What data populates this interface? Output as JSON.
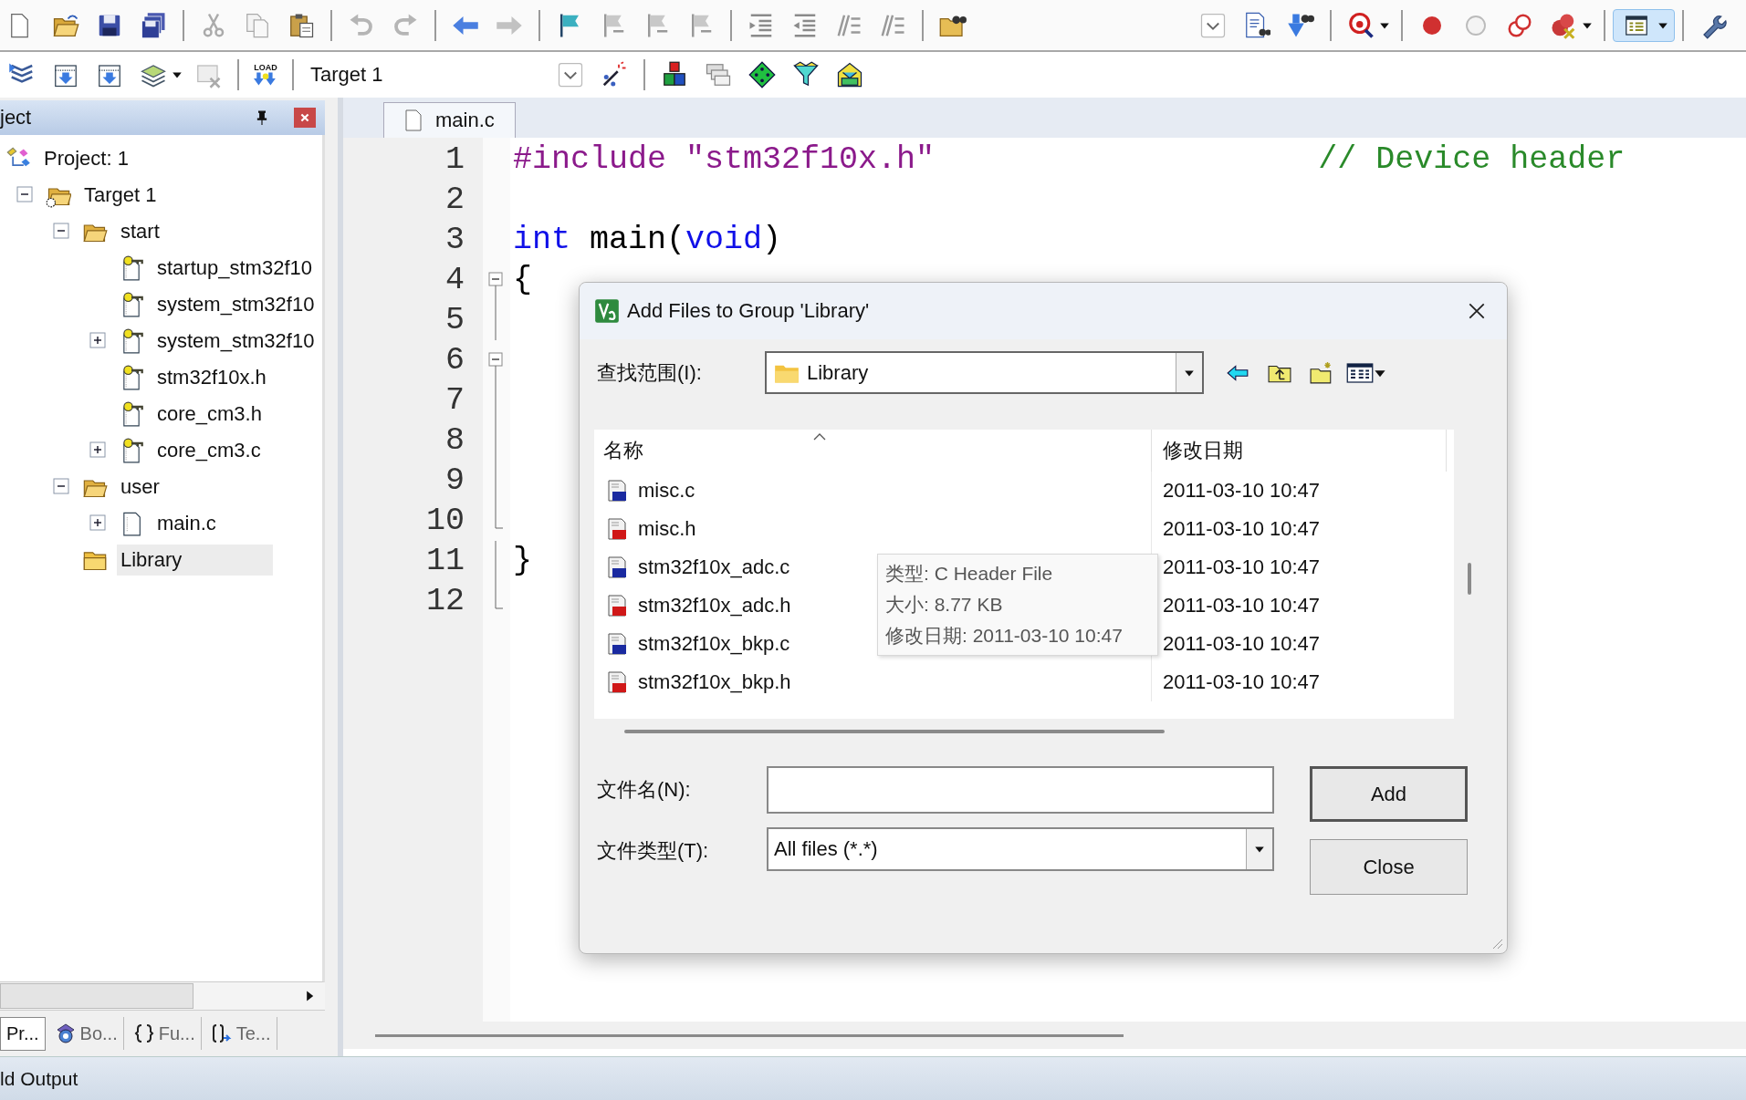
{
  "toolbar": {
    "load_label": "LOAD",
    "target_select": "Target 1"
  },
  "project_panel": {
    "title": "ject",
    "tree": [
      {
        "kind": "project",
        "label": "Project: 1",
        "selected": false,
        "children": [
          {
            "kind": "target",
            "label": "Target 1",
            "expanded": true,
            "selected": false,
            "children": [
              {
                "kind": "group",
                "label": "start",
                "expanded": true,
                "selected": false,
                "children": [
                  {
                    "kind": "keyfile",
                    "label": "startup_stm32f10",
                    "selected": false
                  },
                  {
                    "kind": "keyfile",
                    "label": "system_stm32f10",
                    "selected": false
                  },
                  {
                    "kind": "keyfile",
                    "label": "system_stm32f10",
                    "expanded": false,
                    "selected": false
                  },
                  {
                    "kind": "keyfile",
                    "label": "stm32f10x.h",
                    "selected": false
                  },
                  {
                    "kind": "keyfile",
                    "label": "core_cm3.h",
                    "selected": false
                  },
                  {
                    "kind": "keyfile",
                    "label": "core_cm3.c",
                    "expanded": false,
                    "selected": false
                  }
                ]
              },
              {
                "kind": "group",
                "label": "user",
                "expanded": true,
                "selected": false,
                "children": [
                  {
                    "kind": "file",
                    "label": "main.c",
                    "expanded": false,
                    "selected": false
                  }
                ]
              },
              {
                "kind": "closed_group",
                "label": "Library",
                "selected": true
              }
            ]
          }
        ]
      }
    ],
    "bottom_tabs": [
      {
        "kind": "project",
        "label": "Pr...",
        "selected": true
      },
      {
        "kind": "books",
        "label": "Bo...",
        "selected": false
      },
      {
        "kind": "functions",
        "label": "Fu...",
        "selected": false
      },
      {
        "kind": "templates",
        "label": "Te...",
        "selected": false
      }
    ]
  },
  "editor": {
    "tabs": [
      {
        "label": "main.c",
        "selected": true
      }
    ],
    "lines": [
      {
        "number": "1",
        "kind": "plain",
        "tokens": [
          {
            "kind": "preprocessor",
            "text": "#include"
          },
          {
            "kind": "string",
            "text": " \"stm32f10x.h\""
          },
          {
            "kind": "comment",
            "text": "                    // Device header"
          }
        ]
      },
      {
        "number": "2",
        "kind": "plain"
      },
      {
        "number": "3",
        "kind": "plain",
        "tokens": [
          {
            "kind": "keyword",
            "text": "int"
          },
          {
            "kind": "plain",
            "text": " main("
          },
          {
            "kind": "keyword",
            "text": "void"
          },
          {
            "kind": "plain",
            "text": ")"
          }
        ]
      },
      {
        "number": "4",
        "kind": "fold_start",
        "tokens": [
          {
            "kind": "plain",
            "text": "{"
          }
        ]
      },
      {
        "number": "5",
        "kind": "fold_inner"
      },
      {
        "number": "6",
        "kind": "fold_start"
      },
      {
        "number": "7",
        "kind": "fold_inner"
      },
      {
        "number": "8",
        "kind": "fold_inner"
      },
      {
        "number": "9",
        "kind": "fold_inner"
      },
      {
        "number": "10",
        "kind": "fold_end"
      },
      {
        "number": "11",
        "kind": "fold_inner",
        "tokens": [
          {
            "kind": "plain",
            "text": "}"
          }
        ]
      },
      {
        "number": "12",
        "kind": "fold_end"
      }
    ]
  },
  "dialog": {
    "title": "Add Files to Group 'Library'",
    "look_in": {
      "label": "查找范围(I):",
      "value": "Library"
    },
    "columns": [
      "名称",
      "修改日期"
    ],
    "files": [
      {
        "name": "misc.c",
        "kind": "c",
        "modified": "2011-03-10 10:47"
      },
      {
        "name": "misc.h",
        "kind": "h",
        "modified": "2011-03-10 10:47"
      },
      {
        "name": "stm32f10x_adc.c",
        "kind": "c",
        "modified": "2011-03-10 10:47"
      },
      {
        "name": "stm32f10x_adc.h",
        "kind": "h",
        "modified": "2011-03-10 10:47"
      },
      {
        "name": "stm32f10x_bkp.c",
        "kind": "c",
        "modified": "2011-03-10 10:47"
      },
      {
        "name": "stm32f10x_bkp.h",
        "kind": "h",
        "modified": "2011-03-10 10:47"
      }
    ],
    "tooltip": [
      "类型: C Header File",
      "大小: 8.77 KB",
      "修改日期: 2011-03-10 10:47"
    ],
    "file_name": {
      "label": "文件名(N):"
    },
    "file_type": {
      "label": "文件类型(T):",
      "value": "All files (*.*)"
    },
    "buttons": [
      "Add",
      "Close"
    ]
  },
  "status_bar": {
    "title": "ld Output"
  }
}
